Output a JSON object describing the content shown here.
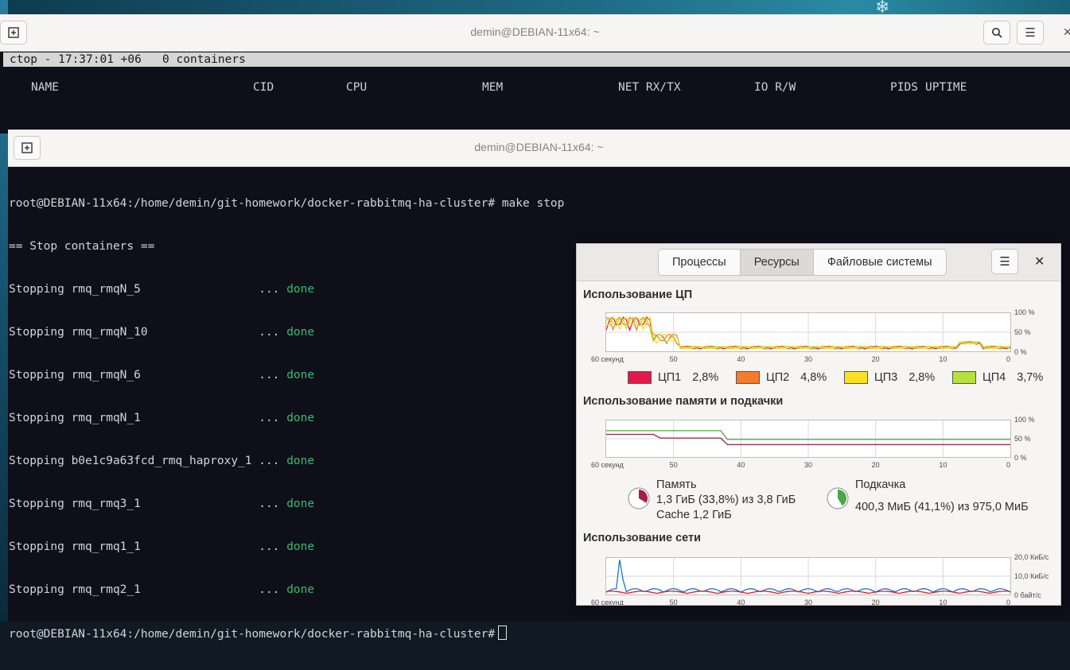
{
  "back_terminal": {
    "title": "demin@DEBIAN-11x64: ~",
    "ctop_status": "ctop - 17:37:01 +06   0 containers",
    "columns": [
      "NAME",
      "CID",
      "CPU",
      "MEM",
      "NET RX/TX",
      "IO R/W",
      "PIDS",
      "UPTIME"
    ]
  },
  "front_terminal": {
    "title": "demin@DEBIAN-11x64: ~",
    "prompt": "root@DEBIAN-11x64:/home/demin/git-homework/docker-rabbitmq-ha-cluster#",
    "command": " make stop",
    "header": "== Stop containers ==",
    "lines": [
      {
        "text": "Stopping rmq_rmqN_5                 ... ",
        "status": "done"
      },
      {
        "text": "Stopping rmq_rmqN_10                ... ",
        "status": "done"
      },
      {
        "text": "Stopping rmq_rmqN_6                 ... ",
        "status": "done"
      },
      {
        "text": "Stopping rmq_rmqN_1                 ... ",
        "status": "done"
      },
      {
        "text": "Stopping b0e1c9a63fcd_rmq_haproxy_1 ... ",
        "status": "done"
      },
      {
        "text": "Stopping rmq_rmq3_1                 ... ",
        "status": "done"
      },
      {
        "text": "Stopping rmq_rmq1_1                 ... ",
        "status": "done"
      },
      {
        "text": "Stopping rmq_rmq2_1                 ... ",
        "status": "done"
      }
    ]
  },
  "system_monitor": {
    "tabs": [
      "Процессы",
      "Ресурсы",
      "Файловые системы"
    ],
    "active_tab": 1,
    "cpu": {
      "title": "Использование ЦП",
      "x_labels": [
        "60 секунд",
        "50",
        "40",
        "30",
        "20",
        "10",
        "0"
      ],
      "y_labels": [
        "100 %",
        "50 %",
        "0 %"
      ],
      "cores": [
        {
          "name": "ЦП1",
          "value": "2,8%",
          "color": "#e01b4c"
        },
        {
          "name": "ЦП2",
          "value": "4,8%",
          "color": "#f57c2c"
        },
        {
          "name": "ЦП3",
          "value": "2,8%",
          "color": "#fbe125"
        },
        {
          "name": "ЦП4",
          "value": "3,7%",
          "color": "#b6e03e"
        }
      ]
    },
    "memory": {
      "title": "Использование памяти и подкачки",
      "x_labels": [
        "60 секунд",
        "50",
        "40",
        "30",
        "20",
        "10",
        "0"
      ],
      "y_labels": [
        "100 %",
        "50 %",
        "0 %"
      ],
      "ram_label": "Память",
      "ram_value": "1,3 ГиБ (33,8%) из 3,8 ГиБ",
      "ram_cache": "Cache 1,2 ГиБ",
      "ram_color": "#a51d4c",
      "ram_percent": 33.8,
      "swap_label": "Подкачка",
      "swap_value": "400,3 МиБ (41,1%) из 975,0 МиБ",
      "swap_color": "#4ba845",
      "swap_percent": 41.1
    },
    "network": {
      "title": "Использование сети",
      "x_labels": [
        "60 секунд",
        "50",
        "40",
        "30",
        "20",
        "10",
        "0"
      ],
      "y_labels": [
        "20,0 КиБ/с",
        "10,0 КиБ/с",
        "0 байт/с"
      ],
      "rx_color": "#1c71d8",
      "tx_color": "#e01b24"
    }
  }
}
